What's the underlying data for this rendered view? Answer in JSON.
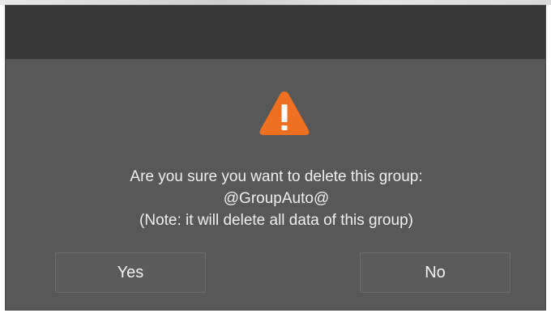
{
  "dialog": {
    "message_line1": "Are you sure you want to delete this group:",
    "message_line2": "@GroupAuto@",
    "message_line3": "(Note: it will delete all data of this group)",
    "yes_label": "Yes",
    "no_label": "No",
    "icon": "warning-icon"
  },
  "colors": {
    "dialog_background": "#585858",
    "titlebar": "#383838",
    "warning": "#f07021",
    "text": "#eeeeee"
  }
}
